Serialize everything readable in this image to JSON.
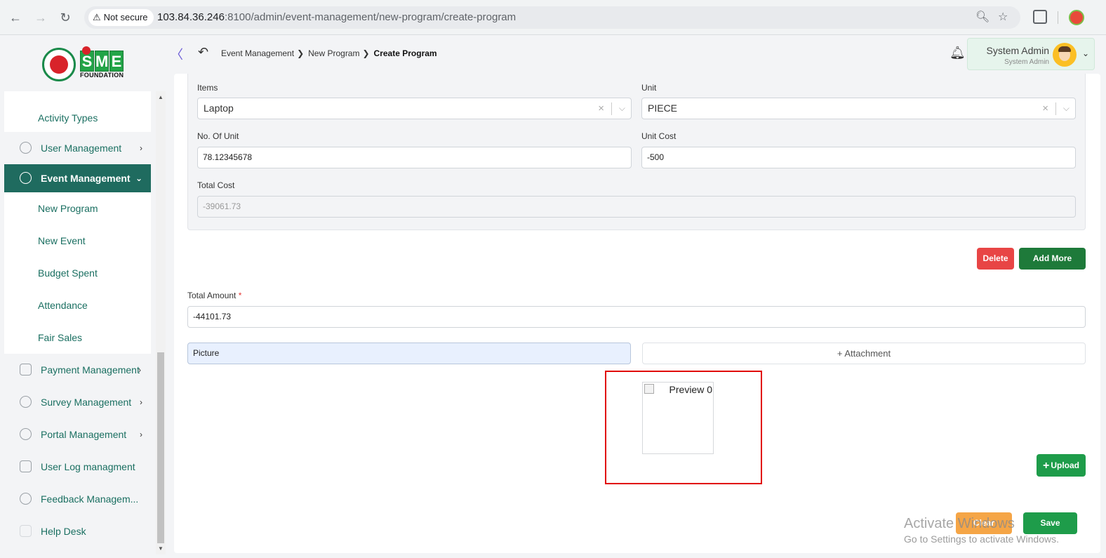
{
  "browser": {
    "security_label": "Not secure",
    "url_host": "103.84.36.246",
    "url_path": ":8100/admin/event-management/new-program/create-program"
  },
  "logo": {
    "sme_letters": [
      "S",
      "M",
      "E"
    ],
    "foundation": "FOUNDATION"
  },
  "sidebar": {
    "sub_top": "Activity Types",
    "user_management": "User Management",
    "event_management": "Event Management",
    "event_sub": [
      "New Program",
      "New Event",
      "Budget Spent",
      "Attendance",
      "Fair Sales"
    ],
    "payment_management": "Payment Management",
    "survey_management": "Survey Management",
    "portal_management": "Portal Management",
    "user_log": "User Log managment",
    "feedback": "Feedback Managem...",
    "help_desk": "Help Desk"
  },
  "header": {
    "breadcrumb": [
      "Event Management",
      "New Program",
      "Create Program"
    ],
    "user_name": "System Admin",
    "user_role": "System Admin"
  },
  "form": {
    "items_label": "Items",
    "items_value": "Laptop",
    "unit_label": "Unit",
    "unit_value": "PIECE",
    "no_of_unit_label": "No. Of Unit",
    "no_of_unit_value": "78.12345678",
    "unit_cost_label": "Unit Cost",
    "unit_cost_value": "-500",
    "total_cost_label": "Total Cost",
    "total_cost_value": "-39061.73",
    "delete_label": "Delete",
    "add_more_label": "Add More",
    "total_amount_label": "Total Amount",
    "total_amount_required": "*",
    "total_amount_value": "-44101.73",
    "picture_label": "Picture",
    "attachment_label": "+ Attachment",
    "preview_alt": "Preview 0",
    "upload_label": "Upload",
    "clear_label": "Clear",
    "save_label": "Save"
  },
  "watermark": {
    "line1": "Activate Windows",
    "line2": "Go to Settings to activate Windows."
  },
  "colors": {
    "primary_green": "#1f6b5f",
    "save_green": "#1e9c4a",
    "delete_red": "#e84545",
    "clear_orange": "#f5a546",
    "highlight_red": "#e10600"
  }
}
